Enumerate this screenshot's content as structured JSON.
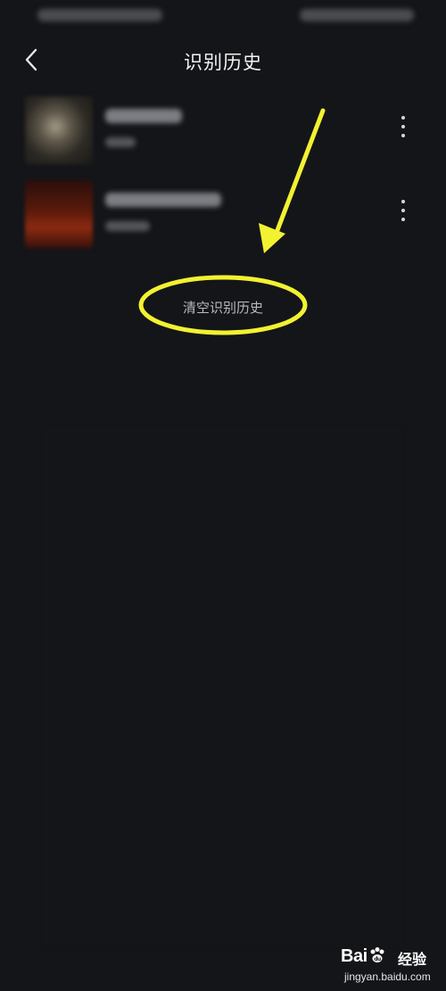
{
  "header": {
    "title": "识别历史",
    "back_icon": "chevron-left-icon"
  },
  "history": {
    "items": [
      {
        "cover_icon": "album-cover-image",
        "title_blurred": true,
        "subtitle_blurred": true,
        "more_icon": "more-vertical-icon"
      },
      {
        "cover_icon": "album-cover-image",
        "title_blurred": true,
        "subtitle_blurred": true,
        "more_icon": "more-vertical-icon"
      }
    ],
    "clear_label": "清空识别历史"
  },
  "annotation": {
    "color": "#f2f230",
    "shapes": [
      "arrow",
      "ellipse"
    ]
  },
  "watermark": {
    "brand": "Bai",
    "brand_suffix": "du",
    "product": "经验",
    "domain": "jingyan.baidu.com"
  },
  "colors": {
    "background": "#141519",
    "title_text": "#f2f2f4",
    "secondary_text": "#b8b9be"
  }
}
